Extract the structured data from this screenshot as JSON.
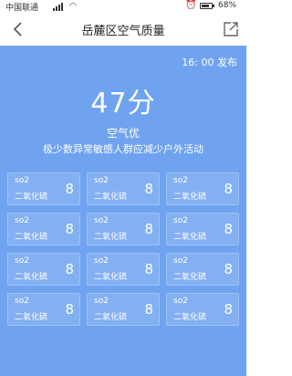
{
  "status_bar": {
    "carrier": "中国联通",
    "battery": "68%",
    "icons": [
      "signal-icon",
      "wifi-icon",
      "alarm-icon",
      "battery-icon"
    ]
  },
  "nav": {
    "title": "岳麓区空气质量",
    "back_icon": "back-arrow-icon",
    "share_icon": "share-icon"
  },
  "main": {
    "background_color": "#6fa3f0",
    "publish_time": "16: 00 发布",
    "score": "47分",
    "level": "空气优",
    "advice": "极少数异常敏感人群应减少户外活动"
  },
  "pollutants": [
    {
      "code": "so2",
      "name": "二氧化硫",
      "value": "8"
    },
    {
      "code": "so2",
      "name": "二氧化硫",
      "value": "8"
    },
    {
      "code": "so2",
      "name": "二氧化硫",
      "value": "8"
    },
    {
      "code": "so2",
      "name": "二氧化硫",
      "value": "8"
    },
    {
      "code": "so2",
      "name": "二氧化硫",
      "value": "8"
    },
    {
      "code": "so2",
      "name": "二氧化硫",
      "value": "8"
    },
    {
      "code": "so2",
      "name": "二氧化硫",
      "value": "8"
    },
    {
      "code": "so2",
      "name": "二氧化硫",
      "value": "8"
    },
    {
      "code": "so2",
      "name": "二氧化硫",
      "value": "8"
    },
    {
      "code": "so2",
      "name": "二氧化硫",
      "value": "8"
    },
    {
      "code": "so2",
      "name": "二氧化硫",
      "value": "8"
    },
    {
      "code": "so2",
      "name": "二氧化硫",
      "value": "8"
    }
  ]
}
